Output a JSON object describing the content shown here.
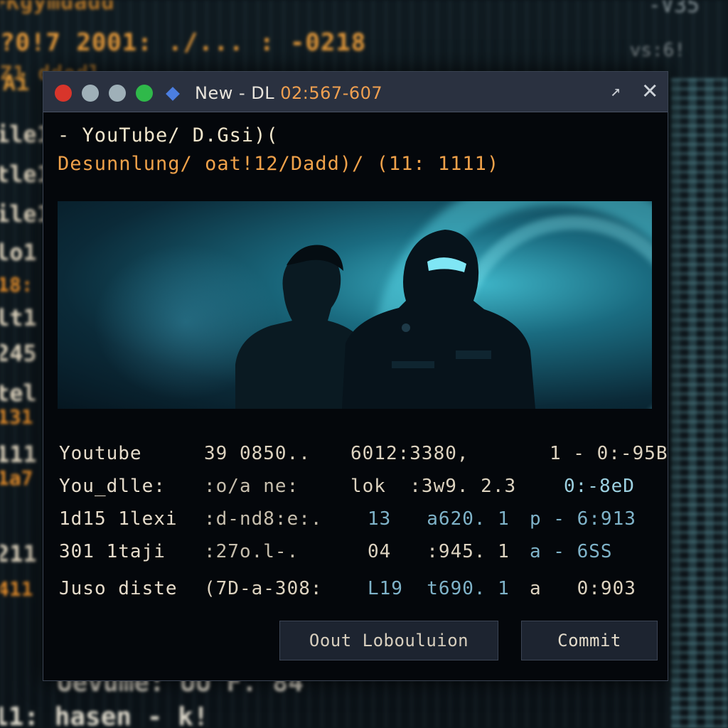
{
  "background": {
    "lines": [
      "+Kgymdadd",
      "?0!7 2001: ./... : -0218",
      "Z1 ddodl",
      "Ai",
      "1",
      "-V35"
    ],
    "left_labels": [
      "ile1",
      "tle1",
      "ile1",
      "lo1",
      "18:",
      "lt1",
      "245",
      "tel",
      "131",
      "111",
      "1a7",
      "211",
      "411"
    ],
    "bottom_lines": [
      "Uevume: UU F. 84",
      "11: hasen - k!"
    ],
    "right_text": "vs:6!"
  },
  "window": {
    "title": "New - DL",
    "subtitle": "02:567-607",
    "minimize_glyph": "↗",
    "close_glyph": "✕"
  },
  "header": {
    "line1": "- YouTube/ D.Gsi)(",
    "line2": "Desunnlung/ oat!12/Dadd)/ (11: 1111)"
  },
  "video": {
    "description_label": ""
  },
  "rows": [
    {
      "name": "Youtube",
      "col1": "39 0850..",
      "col2": "6012:3380,",
      "col3": "1 - 0:-95B"
    },
    {
      "name": "You_dlle:",
      "col1": ":o/a ne:",
      "col2": "lok  :3w9. 2.3",
      "col3": "0:-8eD"
    },
    {
      "name": "1d15 1lexi",
      "col1": ":d-nd8:e:.",
      "col2": "13   a620. 1",
      "col3": "p - 6:913"
    },
    {
      "name": "301 1taji",
      "col1": ":27o.l-.",
      "col2": "04   :945. 1",
      "col3": "a - 6SS"
    },
    {
      "name": "Juso diste",
      "col1": "(7D-a-308:",
      "col2": "L19  t690. 1",
      "col3": "a   0:903"
    }
  ],
  "buttons": {
    "out": "Oout Lobouluion",
    "commit": "Commit"
  },
  "colors": {
    "close": "#d8352b",
    "maximize": "#2fb94a",
    "accent": "#f0a24a",
    "cyan": "#3fb6c9"
  }
}
